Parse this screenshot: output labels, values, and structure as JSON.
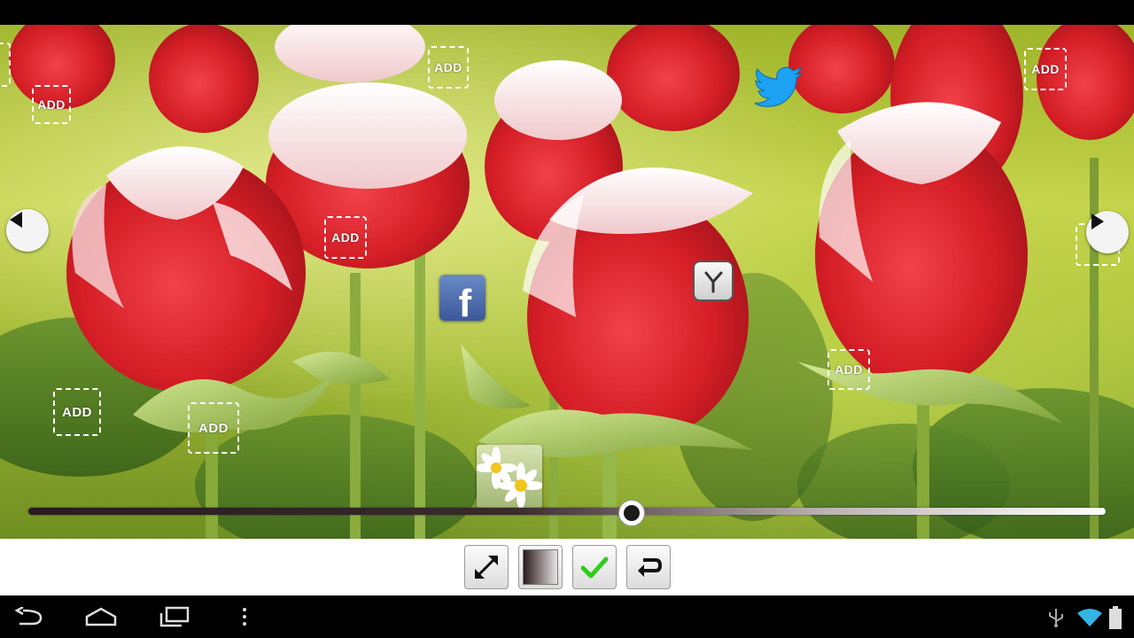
{
  "scene": {
    "wallpaper": "red-white-roses",
    "add_label": "ADD"
  },
  "overlays": {
    "facebook_glyph": "f",
    "social_icons": [
      "facebook-icon",
      "twitter-icon",
      "clock-icon"
    ]
  },
  "slider": {
    "value": 0.56
  },
  "toolbar": {
    "buttons": [
      "expand-icon",
      "gradient-icon",
      "check-icon",
      "undo-icon"
    ]
  },
  "system_nav": {
    "buttons": [
      "back-icon",
      "home-icon",
      "recent-apps-icon",
      "menu-icon"
    ],
    "status_icons": [
      "usb-icon",
      "wifi-icon",
      "battery-icon"
    ]
  },
  "colors": {
    "accent_check": "#2ecc1c",
    "twitter_blue": "#1da1f2",
    "facebook_blue": "#3b5998",
    "wifi_blue": "#33b5e5"
  }
}
